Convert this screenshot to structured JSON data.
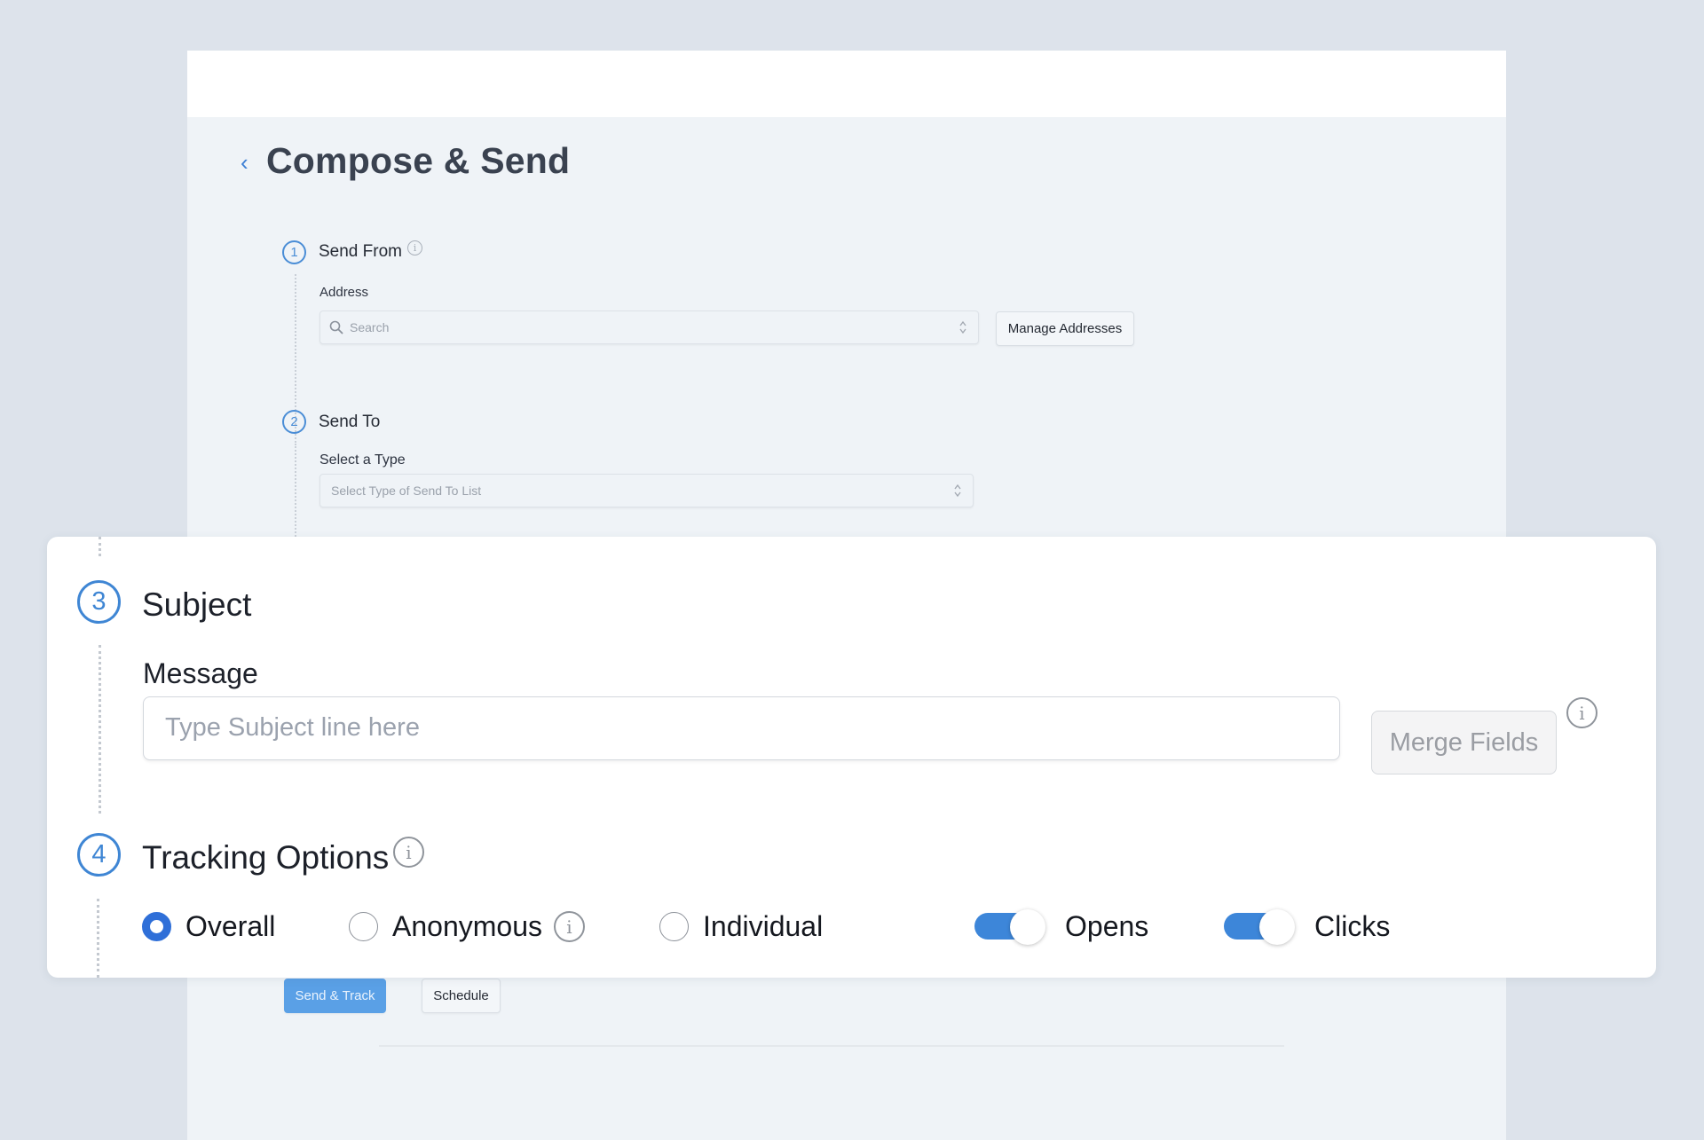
{
  "page": {
    "title": "Compose & Send",
    "back_icon": "chevron-left-icon"
  },
  "steps": {
    "send_from": {
      "number": "1",
      "title": "Send From",
      "address_label": "Address",
      "search_placeholder": "Search",
      "manage_button": "Manage Addresses"
    },
    "send_to": {
      "number": "2",
      "title": "Send To",
      "type_label": "Select a Type",
      "type_placeholder": "Select Type of Send To List"
    },
    "subject": {
      "number": "3",
      "title": "Subject",
      "message_label": "Message",
      "message_placeholder": "Type Subject line here",
      "merge_button": "Merge Fields"
    },
    "tracking": {
      "number": "4",
      "title": "Tracking Options",
      "radio_options": [
        {
          "label": "Overall",
          "checked": true
        },
        {
          "label": "Anonymous",
          "checked": false
        },
        {
          "label": "Individual",
          "checked": false
        }
      ],
      "toggles": [
        {
          "label": "Opens",
          "on": true
        },
        {
          "label": "Clicks",
          "on": true
        }
      ]
    }
  },
  "actions": {
    "send_track": "Send & Track",
    "schedule": "Schedule"
  },
  "icons": {
    "info": "i",
    "chevron": "‹"
  },
  "colors": {
    "accent": "#3f86d4",
    "primary_button": "#5aa0e6",
    "toggle_on": "#3d86d9",
    "radio_checked": "#2f6fd8"
  }
}
